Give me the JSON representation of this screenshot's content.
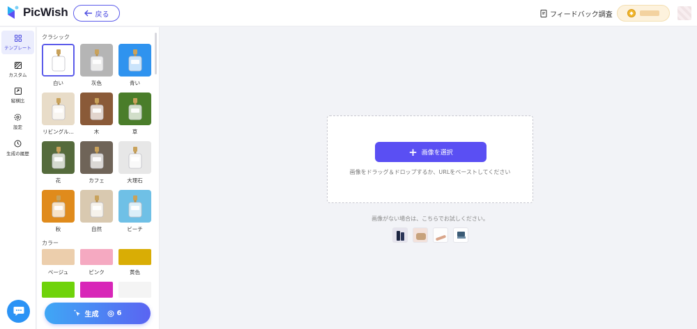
{
  "header": {
    "logo_text": "PicWish",
    "back_label": "戻る",
    "feedback_label": "フィードバック調査"
  },
  "rail": {
    "items": [
      {
        "label": "テンプレート"
      },
      {
        "label": "カスタム"
      },
      {
        "label": "縦横比"
      },
      {
        "label": "設定"
      },
      {
        "label": "生成の履歴"
      }
    ]
  },
  "panel": {
    "classic_title": "クラシック",
    "color_title": "カラー",
    "classic": [
      {
        "label": "白い",
        "bg": "#ffffff"
      },
      {
        "label": "灰色",
        "bg": "#b5b5b5"
      },
      {
        "label": "青い",
        "bg": "#2f93ef"
      },
      {
        "label": "リビングル...",
        "bg": "#e8dcc8"
      },
      {
        "label": "木",
        "bg": "#8a5a38"
      },
      {
        "label": "草",
        "bg": "#4a7d2a"
      },
      {
        "label": "花",
        "bg": "#556b3c"
      },
      {
        "label": "カフェ",
        "bg": "#6f6458"
      },
      {
        "label": "大理石",
        "bg": "#e7e7e7"
      },
      {
        "label": "秋",
        "bg": "#e08b1c"
      },
      {
        "label": "自然",
        "bg": "#d9c9b0"
      },
      {
        "label": "ビーチ",
        "bg": "#6fc0e6"
      }
    ],
    "colors": [
      {
        "label": "ベージュ",
        "color": "#ecceac"
      },
      {
        "label": "ピンク",
        "color": "#f5a9c1"
      },
      {
        "label": "黄色",
        "color": "#d9ad05"
      },
      {
        "label": "",
        "color": "#6fd30a"
      },
      {
        "label": "",
        "color": "#d826b8"
      },
      {
        "label": "",
        "color": "#f4f4f4"
      }
    ],
    "generate_label": "生成",
    "generate_cost": "6"
  },
  "main": {
    "select_label": "画像を選択",
    "drop_hint": "画像をドラッグ＆ドロップするか、URLをペーストしてください",
    "try_text": "画像がない場合は、こちらでお試しください。",
    "samples": [
      "cosmetics-sample",
      "bag-sample",
      "shoe-sample",
      "chair-sample"
    ]
  },
  "colors": {
    "accent": "#5a4ff3",
    "brand_blue": "#2b93f5"
  }
}
